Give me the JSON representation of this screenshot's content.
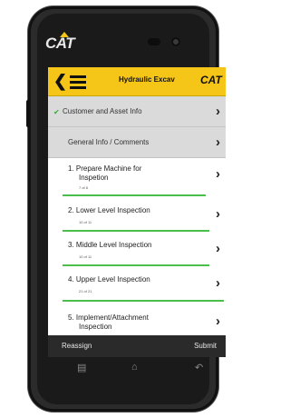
{
  "device": {
    "brand": "CAT"
  },
  "appbar": {
    "back_glyph": "❮",
    "title": "Hydraulic Excav",
    "logo": "CAT"
  },
  "sections": [
    {
      "label": "Customer and Asset Info",
      "checked": true
    },
    {
      "label": "General Info / Comments",
      "checked": false
    }
  ],
  "inspections": [
    {
      "name_line1": "1.  Prepare Machine for",
      "name_line2": "Inspetion",
      "count": "7 of 8",
      "progress": 0.88
    },
    {
      "name_line1": "2.  Lower Level Inspection",
      "name_line2": "",
      "count": "10 of 11",
      "progress": 0.91
    },
    {
      "name_line1": "3.  Middle Level Inspection",
      "name_line2": "",
      "count": "10 of 11",
      "progress": 0.91
    },
    {
      "name_line1": "4.  Upper Level Inspection",
      "name_line2": "",
      "count": "21 of 21",
      "progress": 1.0
    },
    {
      "name_line1": "5.  Implement/Attachment",
      "name_line2": "Inspection",
      "count": "",
      "progress": 0
    }
  ],
  "chevron": "›",
  "bottombar": {
    "reassign": "Reassign",
    "submit": "Submit"
  },
  "navkeys": {
    "recent": "▤",
    "home": "⌂",
    "back": "↶"
  },
  "colors": {
    "accent": "#f5c518",
    "progress": "#4bbf4b"
  }
}
